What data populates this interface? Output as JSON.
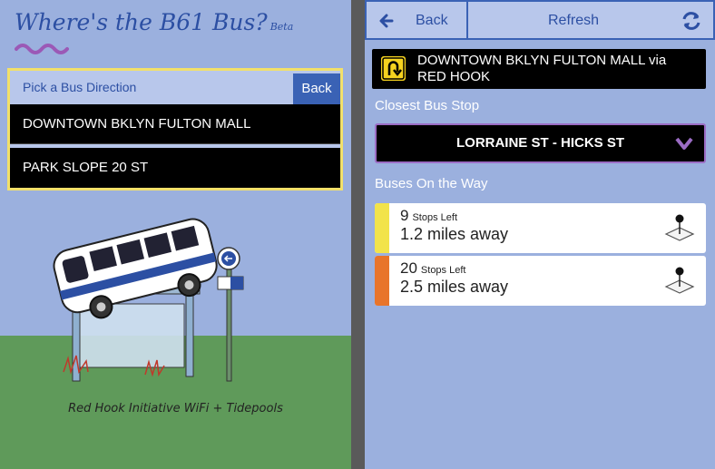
{
  "left": {
    "title": "Where's the B61 Bus?",
    "beta": "Beta",
    "direction_header": "Pick a Bus Direction",
    "back_label": "Back",
    "directions": [
      "DOWNTOWN BKLYN FULTON MALL",
      "PARK SLOPE 20 ST"
    ],
    "caption": "Red Hook Initiative WiFi + Tidepools"
  },
  "right": {
    "back_label": "Back",
    "refresh_label": "Refresh",
    "route": "DOWNTOWN BKLYN FULTON MALL via RED HOOK",
    "closest_label": "Closest Bus Stop",
    "closest_stop": "LORRAINE ST - HICKS ST",
    "buses_label": "Buses On the Way",
    "buses": [
      {
        "stops": "9",
        "stops_label": "Stops Left",
        "distance": "1.2 miles away",
        "color": "#f2e34a"
      },
      {
        "stops": "20",
        "stops_label": "Stops Left",
        "distance": "2.5 miles away",
        "color": "#e8742a"
      }
    ]
  },
  "colors": {
    "background": "#9bb0de",
    "accent": "#3a62b5",
    "title": "#2c4fa3",
    "highlight": "#f2e06a"
  },
  "icons": [
    "back-arrow-icon",
    "refresh-icon",
    "u-turn-icon",
    "chevron-down-icon",
    "map-pin-icon"
  ]
}
